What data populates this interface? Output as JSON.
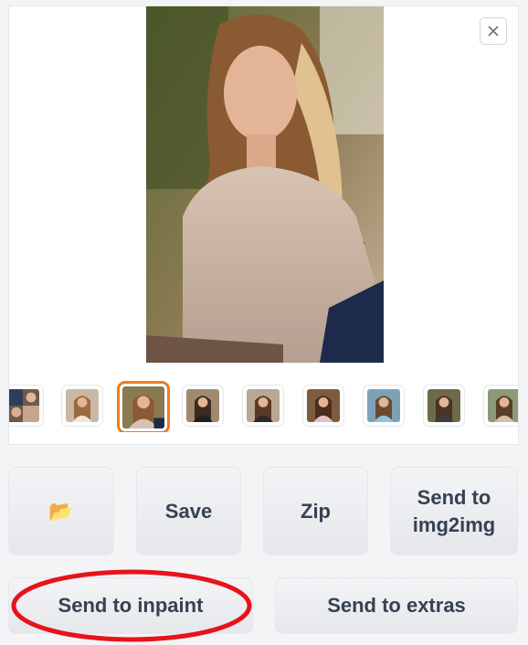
{
  "gallery": {
    "close_icon": "close-icon",
    "selected_index": 1,
    "thumbnail_count": 9
  },
  "buttons": {
    "folder_icon": "📂",
    "save": "Save",
    "zip": "Zip",
    "send_to_img2img_line1": "Send to",
    "send_to_img2img_line2": "img2img",
    "send_to_inpaint": "Send to inpaint",
    "send_to_extras": "Send to extras"
  },
  "colors": {
    "selected_thumb_border": "#f07b1f",
    "annotation_ellipse": "#e8131a",
    "button_text": "#374151"
  }
}
